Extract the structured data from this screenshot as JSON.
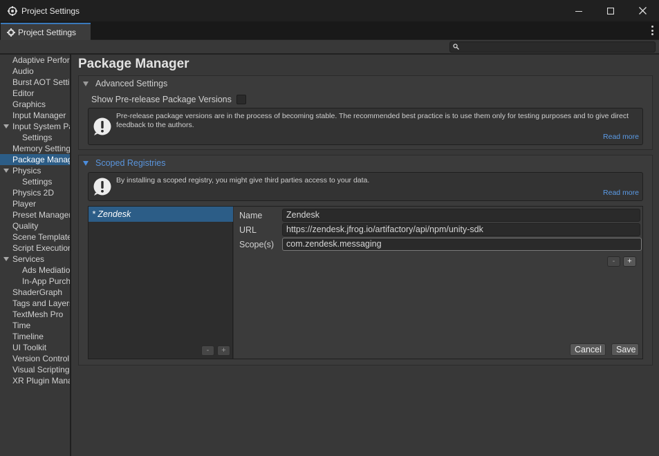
{
  "window": {
    "title": "Project Settings",
    "icon": "unity-settings-icon"
  },
  "tab": {
    "label": "Project Settings",
    "icon": "gear-icon"
  },
  "search": {
    "placeholder": "",
    "value": ""
  },
  "sidebar": {
    "items": [
      {
        "label": "Adaptive Performance",
        "level": 0
      },
      {
        "label": "Audio",
        "level": 0
      },
      {
        "label": "Burst AOT Settings",
        "level": 0
      },
      {
        "label": "Editor",
        "level": 0
      },
      {
        "label": "Graphics",
        "level": 0
      },
      {
        "label": "Input Manager",
        "level": 0
      },
      {
        "label": "Input System Package",
        "level": 0,
        "expanded": true
      },
      {
        "label": "Settings",
        "level": 1
      },
      {
        "label": "Memory Settings",
        "level": 0
      },
      {
        "label": "Package Manager",
        "level": 0,
        "selected": true
      },
      {
        "label": "Physics",
        "level": 0,
        "expanded": true
      },
      {
        "label": "Settings",
        "level": 1
      },
      {
        "label": "Physics 2D",
        "level": 0
      },
      {
        "label": "Player",
        "level": 0
      },
      {
        "label": "Preset Manager",
        "level": 0
      },
      {
        "label": "Quality",
        "level": 0
      },
      {
        "label": "Scene Template",
        "level": 0
      },
      {
        "label": "Script Execution Order",
        "level": 0
      },
      {
        "label": "Services",
        "level": 0,
        "expanded": true
      },
      {
        "label": "Ads Mediation",
        "level": 1
      },
      {
        "label": "In-App Purchasing",
        "level": 1
      },
      {
        "label": "ShaderGraph",
        "level": 0
      },
      {
        "label": "Tags and Layers",
        "level": 0
      },
      {
        "label": "TextMesh Pro",
        "level": 0
      },
      {
        "label": "Time",
        "level": 0
      },
      {
        "label": "Timeline",
        "level": 0
      },
      {
        "label": "UI Toolkit",
        "level": 0
      },
      {
        "label": "Version Control",
        "level": 0
      },
      {
        "label": "Visual Scripting",
        "level": 0
      },
      {
        "label": "XR Plugin Management",
        "level": 0
      }
    ]
  },
  "main": {
    "title": "Package Manager",
    "advanced": {
      "header": "Advanced Settings",
      "prerelease_label": "Show Pre-release Package Versions",
      "prerelease_checked": false,
      "help_text": "Pre-release package versions are in the process of becoming stable. The recommended best practice is to use them only for testing purposes and to give direct feedback to the authors.",
      "read_more": "Read more"
    },
    "scoped": {
      "header": "Scoped Registries",
      "help_text": "By installing a scoped registry, you might give third parties access to your data.",
      "read_more": "Read more",
      "registries": [
        {
          "label": "* Zendesk",
          "selected": true
        }
      ],
      "fields": {
        "name_label": "Name",
        "name_value": "Zendesk",
        "url_label": "URL",
        "url_value": "https://zendesk.jfrog.io/artifactory/api/npm/unity-sdk",
        "scopes_label": "Scope(s)",
        "scopes_value": "com.zendesk.messaging"
      },
      "minus_symbol": "-",
      "plus_symbol": "+",
      "cancel_label": "Cancel",
      "save_label": "Save"
    }
  },
  "colors": {
    "accent": "#2c5d87",
    "link": "#5b9be6",
    "tab_highlight": "#3a79bb"
  }
}
